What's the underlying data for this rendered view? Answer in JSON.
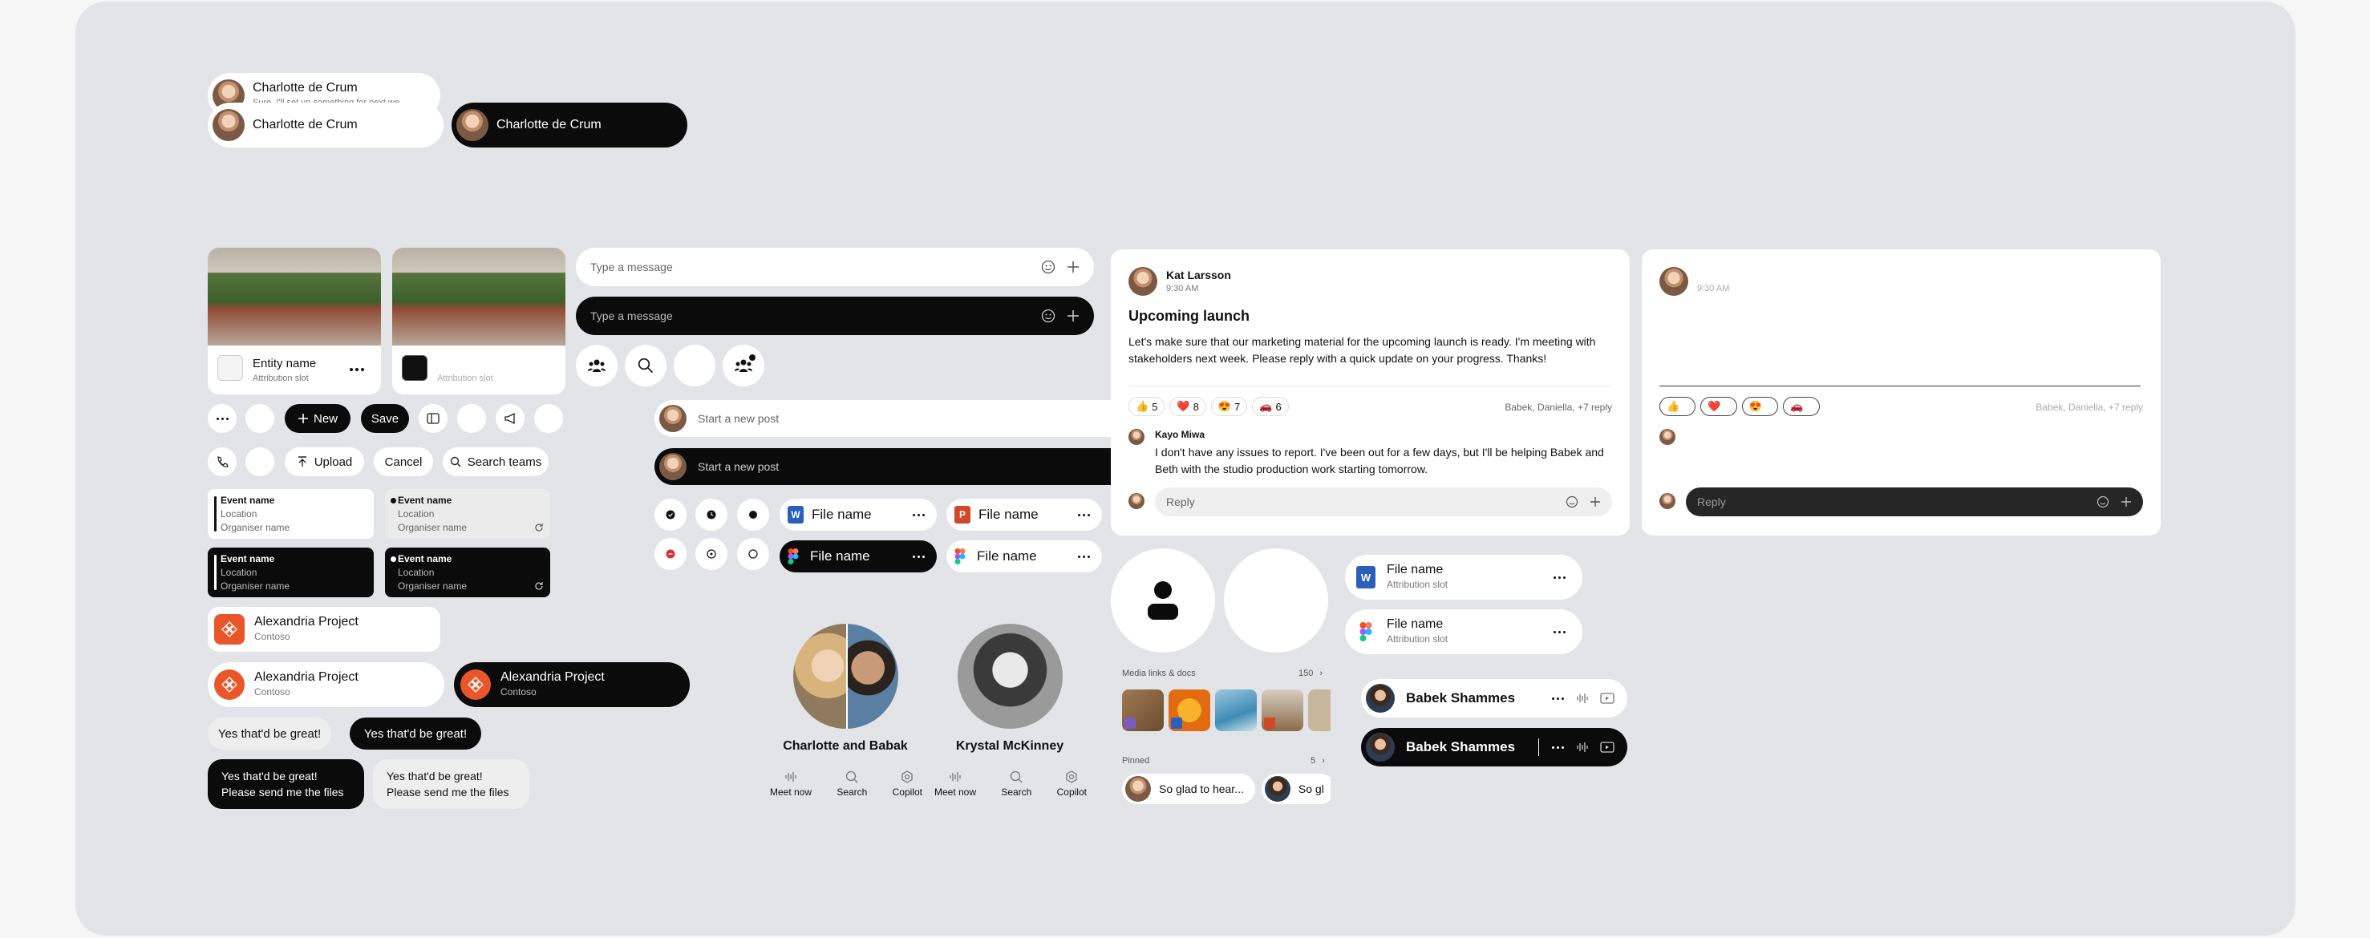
{
  "colors": {
    "accent_orange": "#e8562a",
    "word_blue": "#2b5fbc",
    "ppt_orange": "#d24726",
    "canvas": "#e2e4e8"
  },
  "chat": {
    "person_name": "Charlotte de Crum",
    "preview": "Sure, I'll set up something for next we..."
  },
  "entity": {
    "name": "Entity name",
    "attribution": "Attribution slot"
  },
  "message": {
    "placeholder": "Type a message"
  },
  "post": {
    "placeholder": "Start a new post"
  },
  "buttons": {
    "new": "New",
    "save": "Save",
    "upload": "Upload",
    "cancel": "Cancel",
    "search_teams": "Search teams"
  },
  "event": {
    "name": "Event name",
    "location": "Location",
    "organiser": "Organiser name"
  },
  "file": {
    "name": "File name",
    "attribution": "Attribution slot"
  },
  "project": {
    "name": "Alexandria Project",
    "org": "Contoso"
  },
  "reply_bubbles": {
    "short": "Yes that'd be great!",
    "long_line1": "Yes that'd be great!",
    "long_line2": "Please send me the files"
  },
  "profiles": [
    {
      "name": "Charlotte and Babak",
      "actions": [
        "Meet now",
        "Search",
        "Copilot"
      ]
    },
    {
      "name": "Krystal McKinney",
      "actions": [
        "Meet now",
        "Search",
        "Copilot"
      ]
    }
  ],
  "media": {
    "label": "Media links & docs",
    "count": "150",
    "pinned_label": "Pinned",
    "pinned_count": "5",
    "pinned_msg1": "So glad to hear...",
    "pinned_msg2": "So gl"
  },
  "person_chip": {
    "name": "Babek Shammes"
  },
  "post_card": {
    "author": "Kat Larsson",
    "time": "9:30 AM",
    "title": "Upcoming launch",
    "body": "Let's make sure that our marketing material for the upcoming launch is ready. I'm meeting with stakeholders next week. Please reply with a quick update on your progress. Thanks!",
    "reactions": [
      {
        "emoji": "👍",
        "count": "5"
      },
      {
        "emoji": "❤️",
        "count": "8"
      },
      {
        "emoji": "😍",
        "count": "7"
      },
      {
        "emoji": "🚗",
        "count": "6"
      }
    ],
    "reply_summary": "Babek, Daniella, +7 reply",
    "reply_author": "Kayo Miwa",
    "reply_text": "I don't have any issues to report. I've been out for a few days, but I'll be helping Babek and Beth with the studio production work starting tomorrow.",
    "reply_placeholder": "Reply"
  },
  "icons": [
    "emoji-icon",
    "plus-icon",
    "more-icon",
    "chat-icon",
    "sidebar-icon",
    "voice-icon",
    "megaphone-icon",
    "note-icon",
    "phone-icon",
    "upload-icon",
    "search-icon",
    "people-icon",
    "add-square-icon",
    "refresh-icon",
    "clock-icon",
    "check-icon",
    "record-icon",
    "person-icon",
    "word-icon",
    "figma-icon",
    "ppt-icon",
    "copilot-icon",
    "chevron-right-icon",
    "video-icon"
  ]
}
